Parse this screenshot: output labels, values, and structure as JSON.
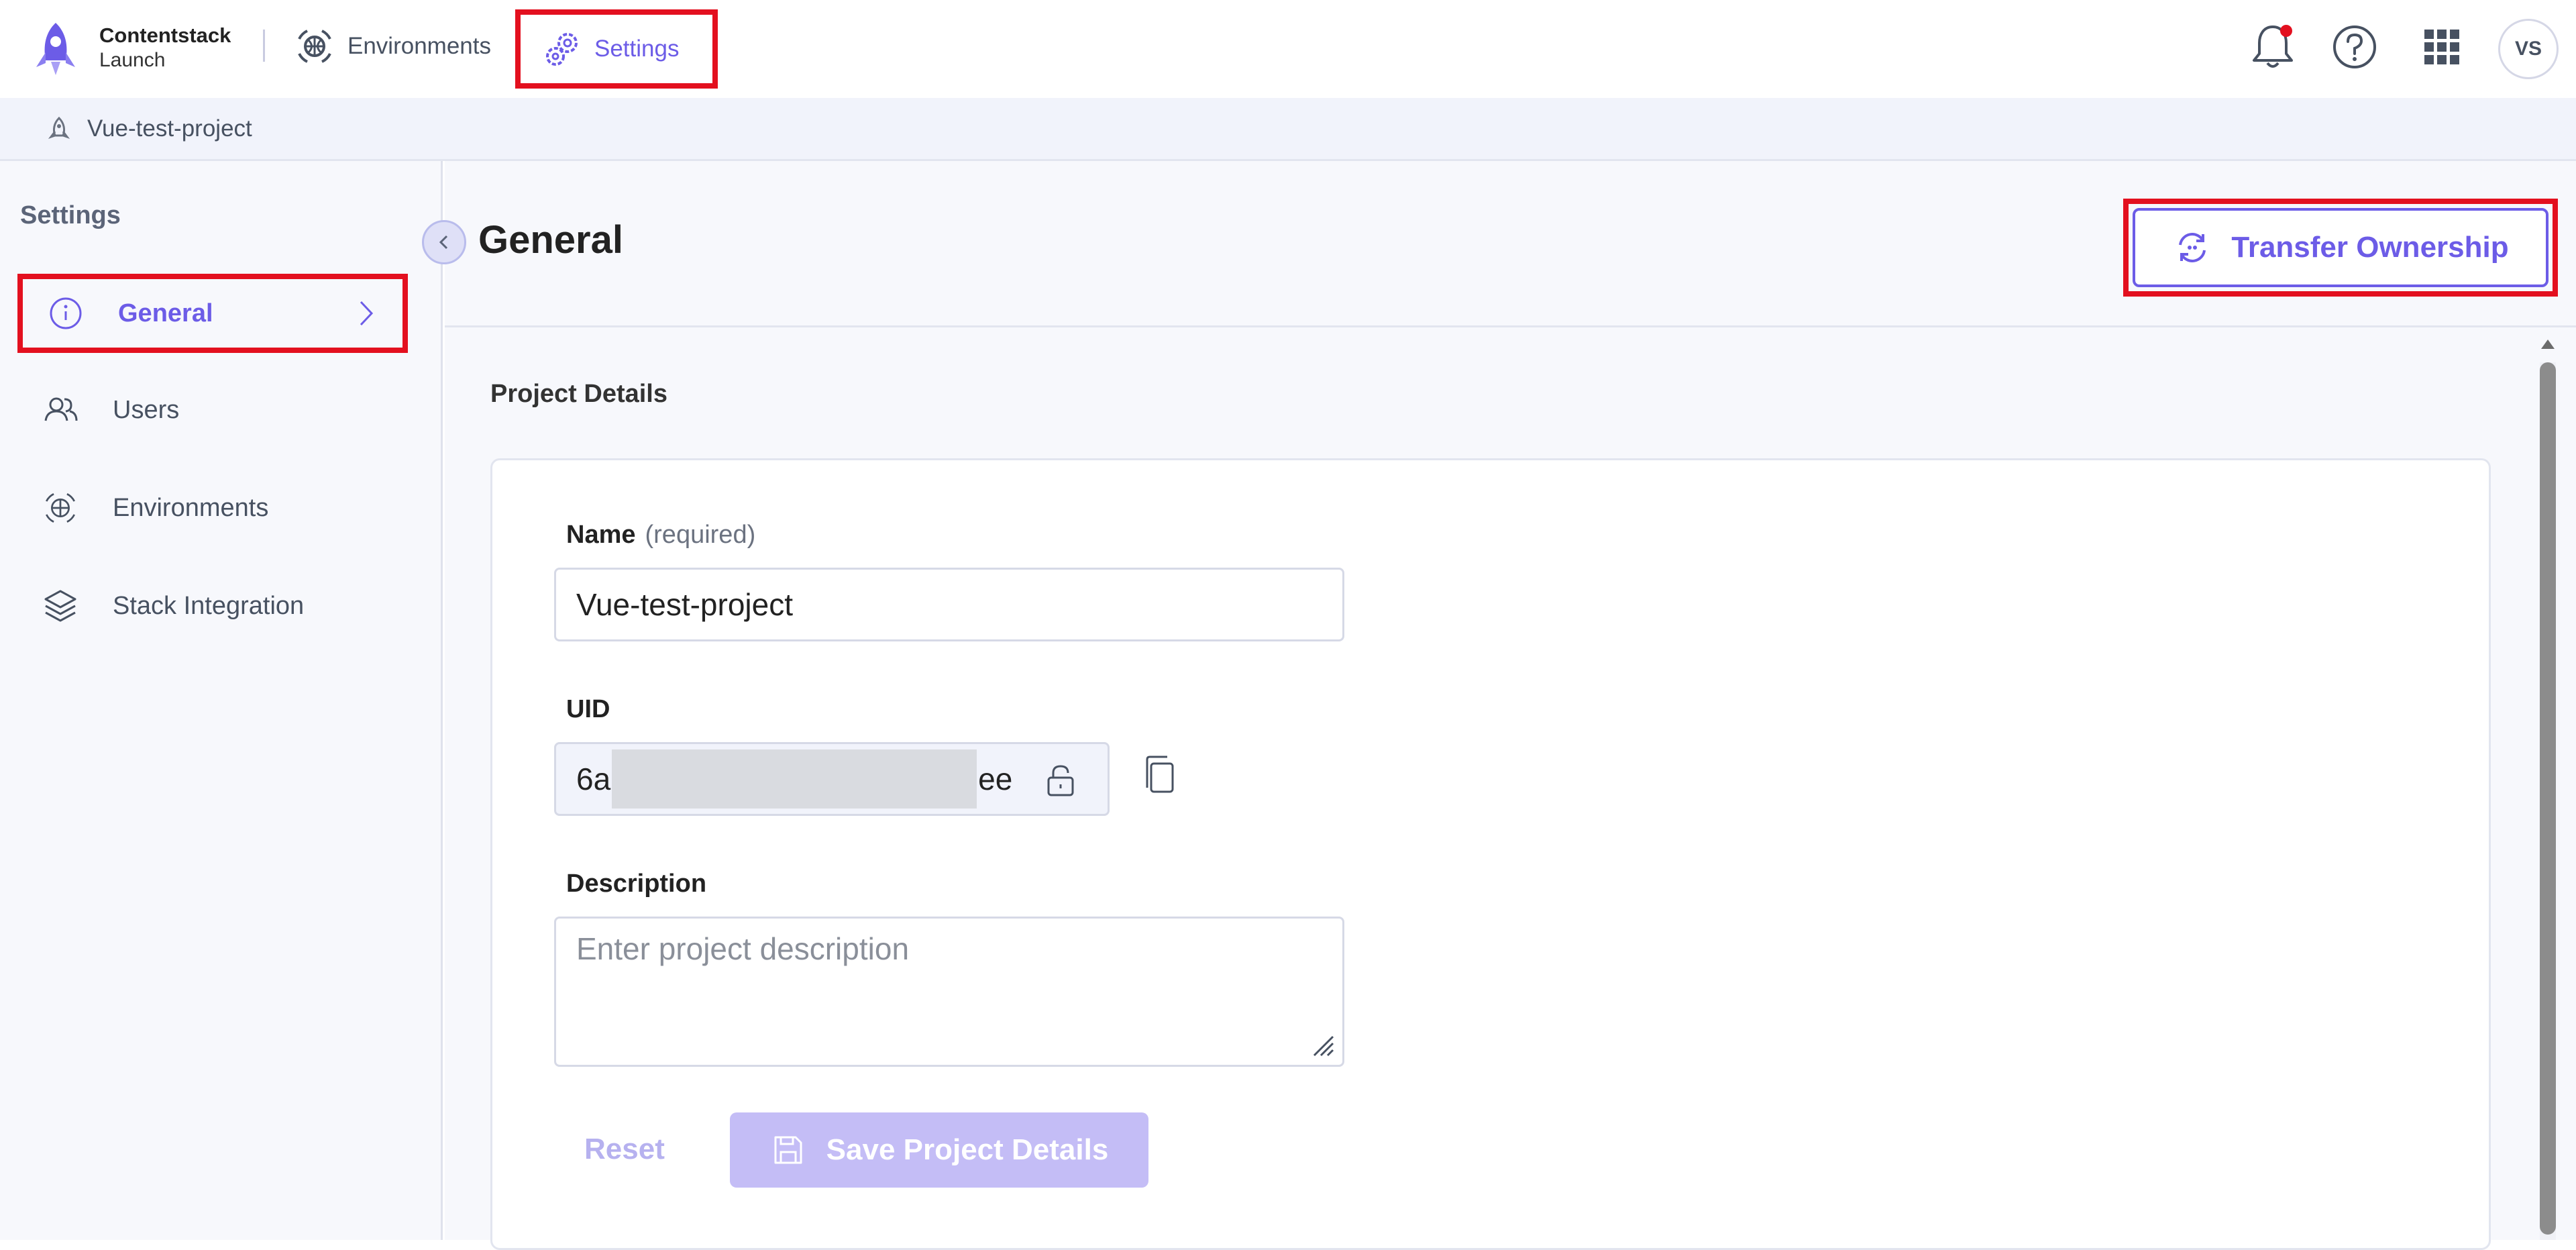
{
  "app": {
    "brand_name": "Contentstack",
    "brand_sub": "Launch",
    "nav": {
      "environments_label": "Environments",
      "settings_label": "Settings"
    },
    "avatar_initials": "VS"
  },
  "breadcrumb": {
    "project": "Vue-test-project"
  },
  "sidebar": {
    "title": "Settings",
    "items": [
      {
        "label": "General",
        "icon": "info-icon",
        "active": true
      },
      {
        "label": "Users",
        "icon": "users-icon"
      },
      {
        "label": "Environments",
        "icon": "environments-icon"
      },
      {
        "label": "Stack Integration",
        "icon": "layers-icon"
      }
    ]
  },
  "main": {
    "title": "General",
    "transfer_label": "Transfer Ownership",
    "section_title": "Project Details",
    "name_label": "Name",
    "name_required": "(required)",
    "name_value": "Vue-test-project",
    "uid_label": "UID",
    "uid_prefix": "6a",
    "uid_suffix": "ee",
    "description_label": "Description",
    "description_placeholder": "Enter project description",
    "reset_label": "Reset",
    "save_label": "Save Project Details"
  },
  "colors": {
    "accent": "#6c5ce7",
    "highlight_box": "#e3101f",
    "notification_dot": "#e3101f"
  }
}
